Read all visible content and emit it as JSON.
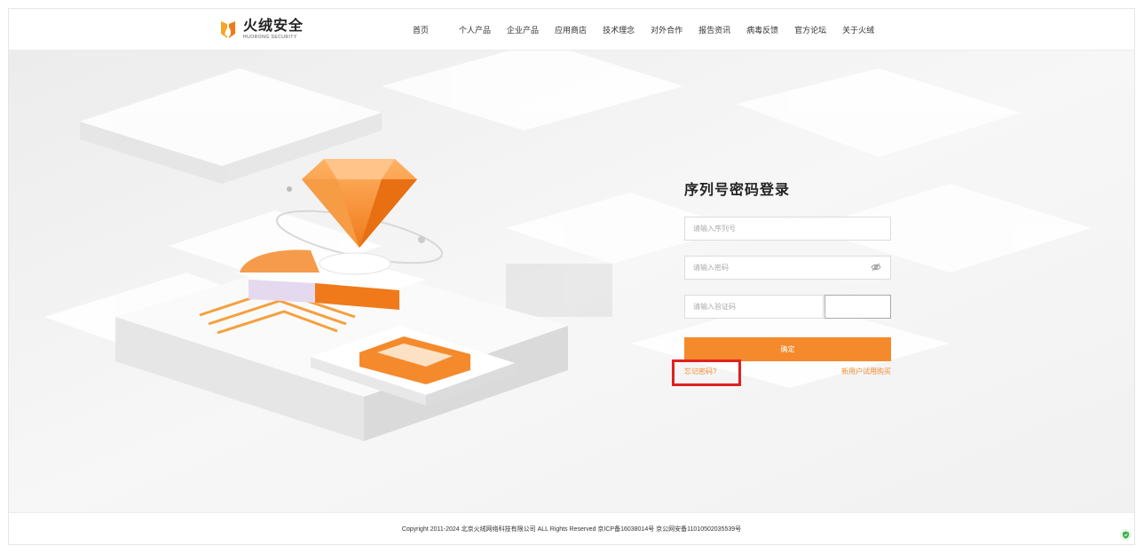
{
  "header": {
    "logo_cn": "火绒安全",
    "logo_en": "HUORONG SECURITY",
    "nav": [
      "首页",
      "个人产品",
      "企业产品",
      "应用商店",
      "技术理念",
      "对外合作",
      "报告资讯",
      "病毒反馈",
      "官方论坛",
      "关于火绒"
    ]
  },
  "login": {
    "title": "序列号密码登录",
    "serial_placeholder": "请输入序列号",
    "password_placeholder": "请输入密码",
    "captcha_placeholder": "请输入验证码",
    "submit_label": "确定",
    "forgot_label": "忘记密码?",
    "trial_label": "新用户试用购买"
  },
  "footer": {
    "copyright": "Copyright 2011-2024 北京火绒网络科技有限公司 ALL Rights Reserved  京ICP备16038014号  京公网安备11010502035539号"
  },
  "colors": {
    "accent": "#f58a2d",
    "highlight_box": "#e02020"
  },
  "icons": {
    "logo": "huorong-flame-logo",
    "password_toggle": "eye-slash-icon",
    "status": "green-shield-icon"
  }
}
